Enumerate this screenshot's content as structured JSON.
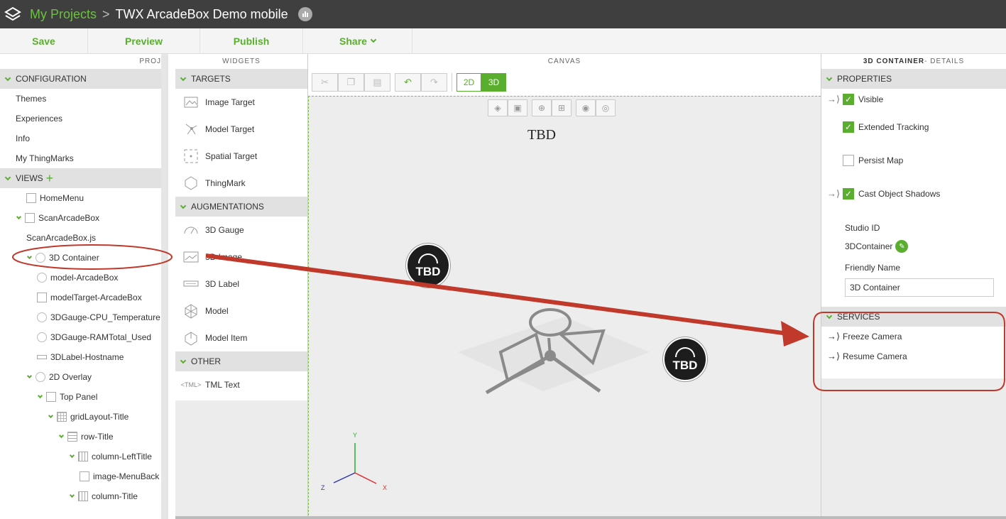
{
  "topbar": {
    "crumb_link": "My Projects",
    "separator": ">",
    "project_title": "TWX ArcadeBox Demo mobile"
  },
  "actions": {
    "save": "Save",
    "preview": "Preview",
    "publish": "Publish",
    "share": "Share"
  },
  "project_panel": {
    "header": "PROJ",
    "configuration": {
      "title": "CONFIGURATION",
      "items": [
        "Themes",
        "Experiences",
        "Info",
        "My ThingMarks"
      ]
    },
    "views": {
      "title": "VIEWS",
      "tree": [
        {
          "label": "HomeMenu"
        },
        {
          "label": "ScanArcadeBox"
        },
        {
          "label": "ScanArcadeBox.js"
        },
        {
          "label": "3D Container"
        },
        {
          "label": "model-ArcadeBox"
        },
        {
          "label": "modelTarget-ArcadeBox"
        },
        {
          "label": "3DGauge-CPU_Temperature"
        },
        {
          "label": "3DGauge-RAMTotal_Used"
        },
        {
          "label": "3DLabel-Hostname"
        },
        {
          "label": "2D Overlay"
        },
        {
          "label": "Top Panel"
        },
        {
          "label": "gridLayout-Title"
        },
        {
          "label": "row-Title"
        },
        {
          "label": "column-LeftTitle"
        },
        {
          "label": "image-MenuBack"
        },
        {
          "label": "column-Title"
        }
      ]
    }
  },
  "widgets_panel": {
    "header": "WIDGETS",
    "targets": {
      "title": "TARGETS",
      "items": [
        "Image Target",
        "Model Target",
        "Spatial Target",
        "ThingMark"
      ]
    },
    "augmentations": {
      "title": "AUGMENTATIONS",
      "items": [
        "3D Gauge",
        "3D Image",
        "3D Label",
        "Model",
        "Model Item"
      ]
    },
    "other": {
      "title": "OTHER",
      "items": [
        "TML Text"
      ]
    },
    "tml_icon_text": "<TML>"
  },
  "canvas": {
    "header": "CANVAS",
    "mode_2d": "2D",
    "mode_3d": "3D",
    "tbd_text": "TBD",
    "gauge_label": "TBD",
    "axis_x": "X",
    "axis_y": "Y",
    "axis_z": "Z"
  },
  "details_panel": {
    "header_strong": "3D CONTAINER",
    "header_rest": " - DETAILS",
    "properties_title": "PROPERTIES",
    "visible": {
      "label": "Visible",
      "checked": true
    },
    "extended_tracking": {
      "label": "Extended Tracking",
      "checked": true
    },
    "persist_map": {
      "label": "Persist Map",
      "checked": false
    },
    "cast_shadows": {
      "label": "Cast Object Shadows",
      "checked": true
    },
    "studio_id_label": "Studio ID",
    "studio_id_value": "3DContainer",
    "friendly_name_label": "Friendly Name",
    "friendly_name_value": "3D Container",
    "services_title": "SERVICES",
    "services": [
      "Freeze Camera",
      "Resume Camera"
    ]
  },
  "colors": {
    "accent": "#5aae2e",
    "topbar": "#3f3f3f",
    "annotation": "#c0392b"
  }
}
